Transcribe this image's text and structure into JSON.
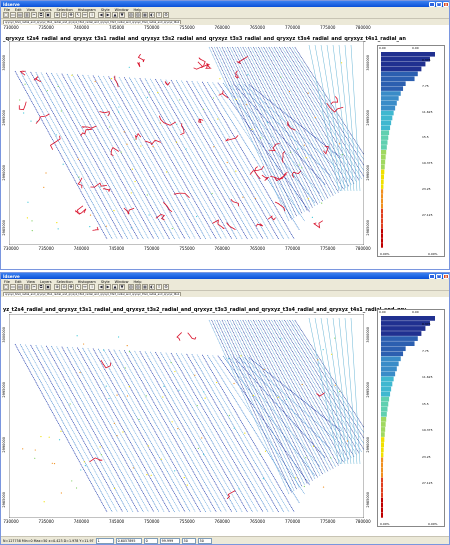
{
  "app": {
    "window_title": "Idserve",
    "min": "_",
    "max": "□",
    "close": "×"
  },
  "menu": [
    "File",
    "Edit",
    "View",
    "Layers",
    "Selection",
    "Histogram",
    "Style",
    "Window",
    "Help"
  ],
  "toolbar_icons": [
    "new-icon",
    "open-icon",
    "save-icon",
    "print-icon",
    "cut-icon",
    "copy-icon",
    "paste-icon",
    "zoom-in-icon",
    "zoom-out-icon",
    "pan-icon",
    "select-icon",
    "measure-icon",
    "info-icon",
    "back-icon",
    "forward-icon",
    "up-icon",
    "down-icon",
    "layers-icon",
    "chart-icon",
    "grid-icon",
    "palette-icon",
    "export-icon",
    "settings-icon"
  ],
  "toolbar_glyphs": [
    "□",
    "▭",
    "▤",
    "▥",
    "✂",
    "⧉",
    "▣",
    "⊕",
    "⊖",
    "✥",
    "↖",
    "↔",
    "i",
    "◀",
    "▶",
    "▲",
    "▼",
    "▧",
    "▨",
    "▦",
    "◐",
    "⇪",
    "⚙"
  ],
  "window1": {
    "tabs": [
      "qryxyz_t2s4_radial_and_qryxyz_t3s1_radial_and_qryxyz_t3s2_radial_and_qryxyz_t3s3_radial_and_qryxyz_t3s4_radial_and_qryxyz_t4s1"
    ],
    "map_title": "_qryxyz_t2s4_radial_and_qryxyz_t3s1_radial_and_qryxyz_t3s2_radial_and_qryxyz_t3s3_radial_and_qryxyz_t3s4_radial_and_qryxyz_t4s1_radial_an",
    "x_ticks": [
      "730000",
      "735000",
      "740000",
      "745000",
      "750000",
      "755000",
      "760000",
      "765000",
      "770000",
      "775000",
      "780000"
    ],
    "y_ticks_left": [
      "3000000",
      "2995000",
      "2990000",
      "2985000"
    ],
    "y_ticks_right": [
      "3000000",
      "2995000",
      "2990000",
      "2985000"
    ],
    "legend": {
      "top": "0.00",
      "max": "0.00",
      "labels": [
        "0.375",
        "7.75",
        "11.625",
        "15.5",
        "19.375",
        "23.25",
        "27.125"
      ],
      "bottom_left": "0.00%",
      "bottom_right": "0.00%"
    }
  },
  "window2": {
    "tabs": [
      "qryxyz_t2s4_radial_and_qryxyz_t3s1_radial_and_qryxyz_t3s2_radial_and_qryxyz_t3s3_radial_and_qryxyz_t3s4_radial_and_qryxyz_t4s1"
    ],
    "map_title": "yz_t2s4_radial_and_qryxyz_t3s1_radial_and_qryxyz_t3s2_radial_and_qryxyz_t3s3_radial_and_qryxyz_t3s4_radial_and_qryxyz_t4s1_radial_and_qry",
    "x_ticks": [
      "730000",
      "735000",
      "740000",
      "745000",
      "750000",
      "755000",
      "760000",
      "765000",
      "770000",
      "775000",
      "780000"
    ],
    "y_ticks_left": [
      "3000000",
      "2995000",
      "2990000",
      "2985000"
    ],
    "y_ticks_right": [
      "3000000",
      "2995000",
      "2990000",
      "2985000"
    ],
    "legend": {
      "top": "0.00",
      "max": "0.00",
      "labels": [
        "0.375",
        "7.75",
        "11.625",
        "15.5",
        "19.375",
        "23.25",
        "27.125"
      ],
      "bottom_left": "0.00%",
      "bottom_right": "0.00%"
    }
  },
  "status": {
    "left": "N=127758  Min=0  Max=50  x=0.423  D=1.978  Y=11.97",
    "fields": [
      "1",
      "0.6057895",
      "0",
      "99.999",
      "50",
      "50"
    ]
  },
  "colors": {
    "low": "#c00000",
    "mid": "#f0e000",
    "cyan": "#40c8d8",
    "high": "#203090"
  }
}
